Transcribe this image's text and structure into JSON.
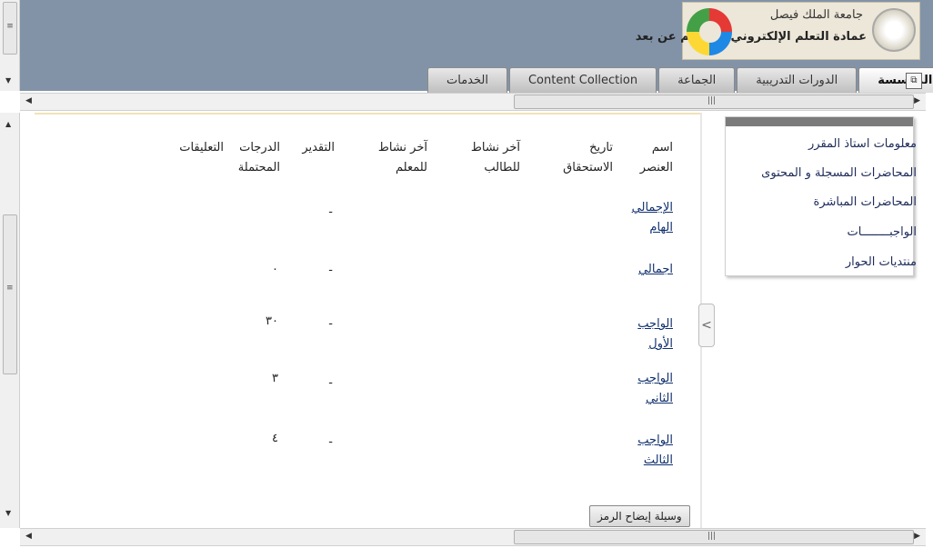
{
  "header": {
    "university_name": "جامعة الملك فيصل",
    "deanship_name": "عمادة التعلم الإلكتروني والتعليم عن بعد"
  },
  "tabs": [
    {
      "label": "المؤسسة",
      "active": true
    },
    {
      "label": "الدورات التدريبية",
      "active": false
    },
    {
      "label": "الجماعة",
      "active": false
    },
    {
      "label": "Content Collection",
      "active": false
    },
    {
      "label": "الخدمات",
      "active": false
    }
  ],
  "columns": {
    "item_name": "اسم العنصر",
    "due_date": "تاريخ الاستحقاق",
    "student_activity": "آخر نشاط للطالب",
    "instructor_activity": "آخر نشاط للمعلم",
    "grade": "التقدير",
    "points_possible": "الدرجات المحتملة",
    "comments": "التعليقات"
  },
  "rows": [
    {
      "name": "الإجمالي الهام",
      "grade": "-",
      "points": ""
    },
    {
      "name": "اجمالي",
      "grade": "-",
      "points": "٠"
    },
    {
      "name": "الواجب الأول",
      "grade": "-",
      "points": "٣٠"
    },
    {
      "name": "الواجب الثاني",
      "grade": "-",
      "points": "٣"
    },
    {
      "name": "الواجب الثالث",
      "grade": "-",
      "points": "٤"
    }
  ],
  "legend_button": "وسيلة إيضاح الرمز",
  "course_menu": [
    "معلومات استاذ المقرر",
    "المحاضرات المسجلة و المحتوى",
    "المحاضرات المباشرة",
    "الواجبــــــــات",
    "منتديات الحوار"
  ],
  "icons": {
    "collapse": "chevron-left-icon",
    "tab_menu": "tab-menu-icon"
  }
}
